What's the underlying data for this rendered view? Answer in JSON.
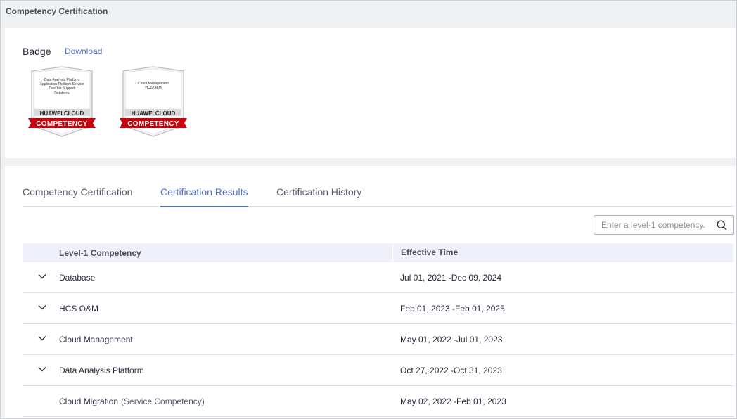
{
  "page_title": "Competency Certification",
  "badge_section": {
    "label": "Badge",
    "download": "Download",
    "badges": [
      {
        "lines": [
          "Data Analysis Platform",
          "Application Platform Service",
          "DevOps Support",
          "Database"
        ],
        "brand": "HUAWEI CLOUD",
        "ribbon": "COMPETENCY"
      },
      {
        "lines": [
          "Cloud Management",
          "HCS O&M"
        ],
        "brand": "HUAWEI CLOUD",
        "ribbon": "COMPETENCY"
      }
    ]
  },
  "tabs": [
    {
      "label": "Competency Certification",
      "active": false
    },
    {
      "label": "Certification Results",
      "active": true
    },
    {
      "label": "Certification History",
      "active": false
    }
  ],
  "search": {
    "placeholder": "Enter a level-1 competency."
  },
  "table": {
    "headers": {
      "competency": "Level-1 Competency",
      "time": "Effective Time"
    },
    "rows": [
      {
        "name": "Database",
        "note": "",
        "time": "Jul 01, 2021 -Dec 09, 2024",
        "expandable": true
      },
      {
        "name": "HCS O&M",
        "note": "",
        "time": "Feb 01, 2023 -Feb 01, 2025",
        "expandable": true
      },
      {
        "name": "Cloud Management",
        "note": "",
        "time": "May 01, 2022 -Jul 01, 2023",
        "expandable": true
      },
      {
        "name": "Data Analysis Platform",
        "note": "",
        "time": "Oct 27, 2022 -Oct 31, 2023",
        "expandable": true
      },
      {
        "name": "Cloud Migration",
        "note": "(Service Competency)",
        "time": "May 02, 2022 -Feb 01, 2023",
        "expandable": false
      }
    ]
  },
  "colors": {
    "accent": "#526ecc",
    "ribbon": "#c7000b",
    "header_bg": "#eef1fa"
  }
}
